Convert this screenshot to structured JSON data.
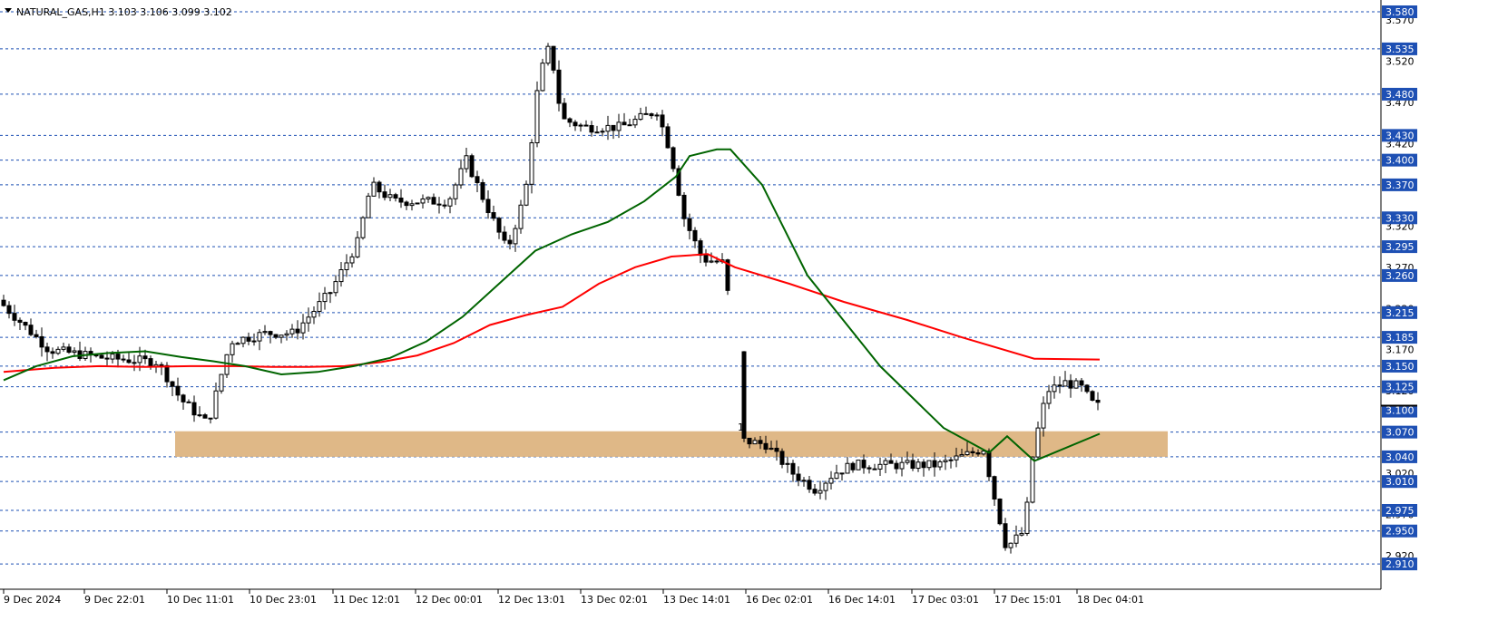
{
  "chart_data": {
    "type": "candlestick",
    "title": "NATURAL_GAS,H1  3.103 3.106 3.099 3.102",
    "ylim": [
      2.905,
      3.585
    ],
    "x_tick_labels": [
      "9 Dec 2024",
      "9 Dec 22:01",
      "10 Dec 11:01",
      "10 Dec 23:01",
      "11 Dec 12:01",
      "12 Dec 00:01",
      "12 Dec 13:01",
      "13 Dec 02:01",
      "13 Dec 14:01",
      "16 Dec 02:01",
      "16 Dec 14:01",
      "17 Dec 03:01",
      "17 Dec 15:01",
      "18 Dec 04:01"
    ],
    "y_plain_ticks": [
      "3.570",
      "3.520",
      "3.470",
      "3.420",
      "3.370",
      "3.320",
      "3.270",
      "3.220",
      "3.170",
      "3.120",
      "3.070",
      "3.020",
      "2.970",
      "2.920"
    ],
    "levels": [
      3.58,
      3.535,
      3.48,
      3.43,
      3.4,
      3.37,
      3.33,
      3.295,
      3.26,
      3.215,
      3.185,
      3.15,
      3.125,
      3.07,
      3.04,
      3.01,
      2.975,
      2.95,
      2.91
    ],
    "level_labels": [
      "3.580",
      "3.535",
      "3.480",
      "3.430",
      "3.400",
      "3.370",
      "3.330",
      "3.295",
      "3.260",
      "3.215",
      "3.185",
      "3.150",
      "3.125",
      "3.070",
      "3.040",
      "3.010",
      "2.975",
      "2.950",
      "2.910"
    ],
    "current_price": 3.102,
    "current_price_label": "3.100",
    "zone": {
      "low": 3.04,
      "high": 3.071
    },
    "ma_fast": [
      3.133,
      3.15,
      3.162,
      3.166,
      3.168,
      3.161,
      3.156,
      3.15,
      3.14,
      3.143,
      3.15,
      3.16,
      3.18,
      3.21,
      3.25,
      3.29,
      3.31,
      3.325,
      3.35,
      3.38,
      3.405,
      3.413,
      3.413,
      3.37,
      3.26,
      3.15,
      3.075,
      3.045,
      3.065,
      3.035,
      3.068
    ],
    "ma_slow": [
      3.143,
      3.148,
      3.15,
      3.149,
      3.15,
      3.15,
      3.149,
      3.149,
      3.15,
      3.155,
      3.163,
      3.178,
      3.2,
      3.212,
      3.222,
      3.25,
      3.27,
      3.283,
      3.286,
      3.27,
      3.25,
      3.228,
      3.206,
      3.185,
      3.159,
      3.158
    ],
    "marker_text": "1",
    "colors": {
      "bull": "#ffffff",
      "bear": "#000000",
      "ma_fast": "#006400",
      "ma_slow": "#ff0000",
      "zone": "#dfb887",
      "grid": "#1e50b4",
      "label_box": "#1e50b4"
    }
  }
}
